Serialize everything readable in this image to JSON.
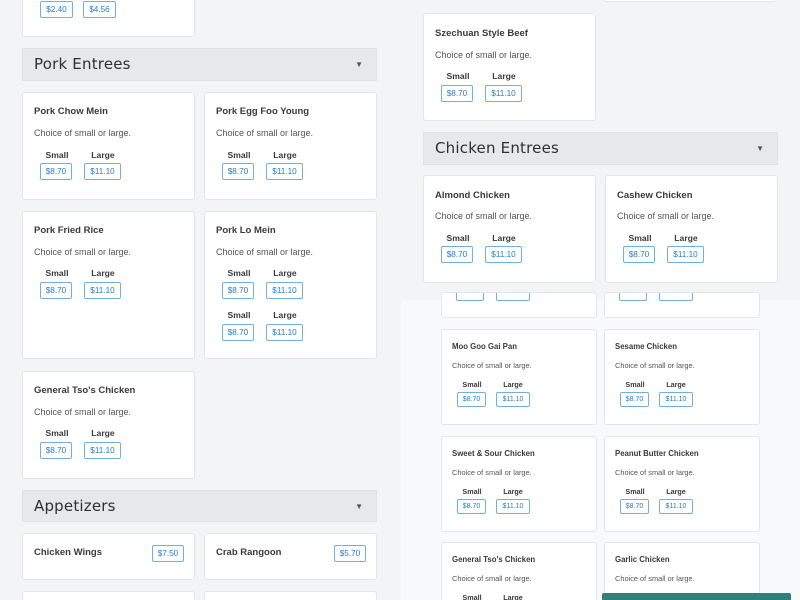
{
  "desc": "Choice of small or large.",
  "labels": {
    "small": "Small",
    "large": "Large"
  },
  "prices": {
    "small": "$8.70",
    "large": "$11.10"
  },
  "top_prices": {
    "p1": "$2.40",
    "p2": "$4.56"
  },
  "sections": {
    "pork": "Pork Entrees",
    "chicken": "Chicken Entrees",
    "appetizers": "Appetizers"
  },
  "items": {
    "szechuan_beef": "Szechuan Style Beef",
    "pork_chow_mein": "Pork Chow Mein",
    "pork_egg_foo_young": "Pork Egg Foo Young",
    "pork_fried_rice": "Pork Fried Rice",
    "pork_lo_mein": "Pork Lo Mein",
    "general_tso_left": "General Tso's Chicken",
    "almond_chicken": "Almond Chicken",
    "cashew_chicken": "Cashew Chicken",
    "moo_goo_gai_pan": "Moo Goo Gai Pan",
    "sesame_chicken": "Sesame Chicken",
    "sweet_sour_chicken": "Sweet & Sour Chicken",
    "peanut_butter_chicken": "Peanut Butter Chicken",
    "general_tso_overlay": "General Tso's Chicken",
    "garlic_chicken": "Garlic Chicken",
    "chicken_wings": "Chicken Wings",
    "crab_rangoon": "Crab Rangoon"
  },
  "appetizer_prices": {
    "chicken_wings": "$7.50",
    "crab_rangoon": "$5.70"
  },
  "caret": "▼",
  "colors": {
    "accent": "#2b7bc1",
    "price_border": "#6fb0e4",
    "cta": "#2f7f7b"
  }
}
